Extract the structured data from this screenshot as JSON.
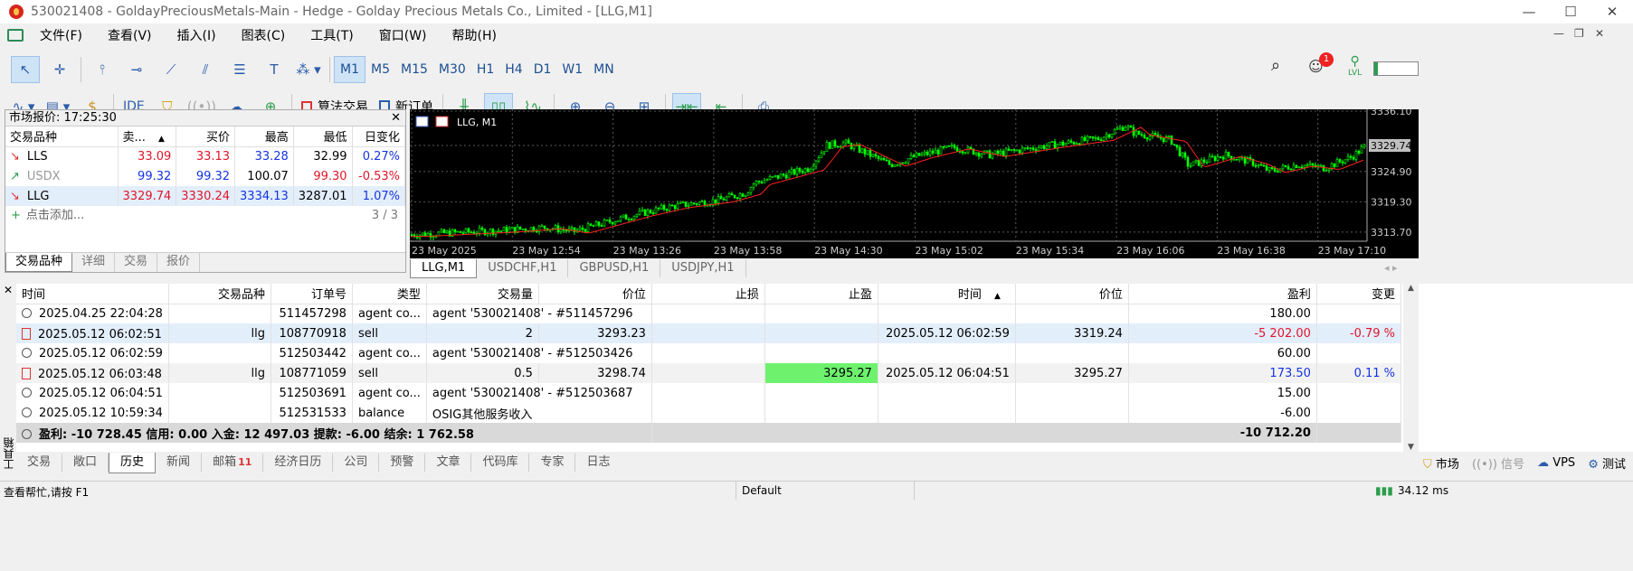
{
  "window": {
    "title": "530021408 - GoldayPreciousMetals-Main - Hedge - Golday Precious Metals Co., Limited - [LLG,M1]"
  },
  "menu": [
    "文件(F)",
    "查看(V)",
    "插入(I)",
    "图表(C)",
    "工具(T)",
    "窗口(W)",
    "帮助(H)"
  ],
  "timeframes": [
    "M1",
    "M5",
    "M15",
    "M30",
    "H1",
    "H4",
    "D1",
    "W1",
    "MN"
  ],
  "toolbar2": {
    "ide": "IDE",
    "algo": "算法交易",
    "new_order": "新订单"
  },
  "notifications": {
    "count": "1",
    "lvl": "LVL"
  },
  "market_watch": {
    "title": "市场报价: 17:25:30",
    "columns": [
      "交易品种",
      "卖...",
      "买价",
      "最高",
      "最低",
      "日变化"
    ],
    "rows": [
      {
        "symbol": "LLS",
        "bid": "33.09",
        "ask": "33.13",
        "high": "33.28",
        "low": "32.99",
        "change": "0.27%"
      },
      {
        "symbol": "USDX",
        "bid": "99.32",
        "ask": "99.32",
        "high": "100.07",
        "low": "99.30",
        "change": "-0.53%"
      },
      {
        "symbol": "LLG",
        "bid": "3329.74",
        "ask": "3330.24",
        "high": "3334.13",
        "low": "3287.01",
        "change": "1.07%"
      }
    ],
    "add_label": "点击添加...",
    "count": "3 / 3",
    "tabs": [
      "交易品种",
      "详细",
      "交易",
      "报价"
    ]
  },
  "chart": {
    "label": "LLG, M1",
    "price_labels": [
      "3336.10",
      "3329.74",
      "3324.90",
      "3319.30",
      "3313.70"
    ],
    "time_labels": [
      "23 May 2025",
      "23 May 12:54",
      "23 May 13:26",
      "23 May 13:58",
      "23 May 14:30",
      "23 May 15:02",
      "23 May 15:34",
      "23 May 16:06",
      "23 May 16:38",
      "23 May 17:10"
    ],
    "tabs": [
      "LLG,M1",
      "USDCHF,H1",
      "GBPUSD,H1",
      "USDJPY,H1"
    ],
    "colors": {
      "bull": "#00ff00",
      "ma": "#ff2020",
      "bg": "#000000",
      "grid": "#808080"
    }
  },
  "history": {
    "columns": [
      "时间",
      "交易品种",
      "订单号",
      "类型",
      "交易量",
      "价位",
      "止损",
      "止盈",
      "时间",
      "价位",
      "盈利",
      "变更"
    ],
    "rows": [
      {
        "icon": "plus",
        "time": "2025.04.25 22:04:28",
        "symbol": "",
        "order": "511457298",
        "type": "agent co...",
        "volume": "agent '530021408' - #511457296",
        "price": "",
        "sl": "",
        "tp": "",
        "time2": "",
        "price2": "",
        "profit": "180.00",
        "change": ""
      },
      {
        "icon": "doc",
        "time": "2025.05.12 06:02:51",
        "symbol": "llg",
        "order": "108770918",
        "type": "sell",
        "volume": "2",
        "price": "3293.23",
        "sl": "",
        "tp": "",
        "time2": "2025.05.12 06:02:59",
        "price2": "3319.24",
        "profit": "-5 202.00",
        "change": "-0.79 %"
      },
      {
        "icon": "plus",
        "time": "2025.05.12 06:02:59",
        "symbol": "",
        "order": "512503442",
        "type": "agent co...",
        "volume": "agent '530021408' - #512503426",
        "price": "",
        "sl": "",
        "tp": "",
        "time2": "",
        "price2": "",
        "profit": "60.00",
        "change": ""
      },
      {
        "icon": "doc",
        "time": "2025.05.12 06:03:48",
        "symbol": "llg",
        "order": "108771059",
        "type": "sell",
        "volume": "0.5",
        "price": "3298.74",
        "sl": "",
        "tp": "3295.27",
        "time2": "2025.05.12 06:04:51",
        "price2": "3295.27",
        "profit": "173.50",
        "change": "0.11 %"
      },
      {
        "icon": "plus",
        "time": "2025.05.12 06:04:51",
        "symbol": "",
        "order": "512503691",
        "type": "agent co...",
        "volume": "agent '530021408' - #512503687",
        "price": "",
        "sl": "",
        "tp": "",
        "time2": "",
        "price2": "",
        "profit": "15.00",
        "change": ""
      },
      {
        "icon": "minus",
        "time": "2025.05.12 10:59:34",
        "symbol": "",
        "order": "512531533",
        "type": "balance",
        "volume": "OSIG其他服务收入",
        "price": "",
        "sl": "",
        "tp": "",
        "time2": "",
        "price2": "",
        "profit": "-6.00",
        "change": ""
      }
    ],
    "summary": {
      "text": "盈利: -10 728.45  信用: 0.00  入金: 12 497.03  提款: -6.00  结余: 1 762.58",
      "total": "-10 712.20"
    }
  },
  "toolbox": {
    "label": "工具箱",
    "tabs": [
      "交易",
      "敞口",
      "历史",
      "新闻",
      "邮箱",
      "经济日历",
      "公司",
      "预警",
      "文章",
      "代码库",
      "专家",
      "日志"
    ],
    "mail_badge": "11",
    "right": [
      "市场",
      "信号",
      "VPS",
      "测试"
    ]
  },
  "status": {
    "help": "查看帮忙,请按 F1",
    "profile": "Default",
    "ping": "34.12 ms"
  }
}
